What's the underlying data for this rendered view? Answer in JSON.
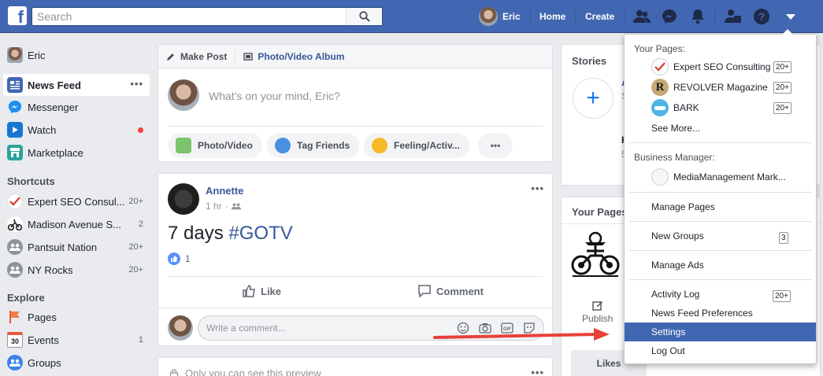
{
  "topbar": {
    "search_placeholder": "Search",
    "user_name": "Eric",
    "home_label": "Home",
    "create_label": "Create"
  },
  "leftnav": {
    "user": "Eric",
    "items": [
      {
        "label": "News Feed",
        "icon": "newsfeed-icon"
      },
      {
        "label": "Messenger",
        "icon": "messenger-icon"
      },
      {
        "label": "Watch",
        "icon": "watch-icon"
      },
      {
        "label": "Marketplace",
        "icon": "marketplace-icon"
      }
    ],
    "shortcuts_title": "Shortcuts",
    "shortcuts": [
      {
        "label": "Expert SEO Consul...",
        "count": "20+"
      },
      {
        "label": "Madison Avenue S...",
        "count": "2"
      },
      {
        "label": "Pantsuit Nation",
        "count": "20+"
      },
      {
        "label": "NY Rocks",
        "count": "20+"
      }
    ],
    "explore_title": "Explore",
    "explore": [
      {
        "label": "Pages",
        "count": ""
      },
      {
        "label": "Events",
        "count": "1",
        "icon_text": "30"
      },
      {
        "label": "Groups",
        "count": ""
      }
    ]
  },
  "composer": {
    "tab_make_post": "Make Post",
    "tab_album": "Photo/Video Album",
    "placeholder": "What's on your mind, Eric?",
    "btn_photo": "Photo/Video",
    "btn_tag": "Tag Friends",
    "btn_feeling": "Feeling/Activ..."
  },
  "post": {
    "author": "Annette",
    "time": "1 hr",
    "text_plain": "7 days ",
    "text_tag": "#GOTV",
    "likes": "1",
    "like_label": "Like",
    "comment_label": "Comment",
    "comment_placeholder": "Write a comment..."
  },
  "preview": {
    "text": "Only you can see this preview"
  },
  "right": {
    "stories_title": "Stories",
    "your_pages_title": "Your Pages",
    "publish_label": "Publish",
    "likes_label": "Likes"
  },
  "dropdown": {
    "your_pages_head": "Your Pages:",
    "pages": [
      {
        "label": "Expert SEO Consulting",
        "badge": "20+"
      },
      {
        "label": "REVOLVER Magazine",
        "badge": "20+"
      },
      {
        "label": "BARK",
        "badge": "20+"
      }
    ],
    "see_more": "See More...",
    "bm_head": "Business Manager:",
    "bm_item": "MediaManagement Mark...",
    "manage_pages": "Manage Pages",
    "new_groups": "New Groups",
    "new_groups_badge": "3",
    "manage_ads": "Manage Ads",
    "activity_log": "Activity Log",
    "activity_badge": "20+",
    "news_feed_prefs": "News Feed Preferences",
    "settings": "Settings",
    "log_out": "Log Out"
  },
  "colors": {
    "brand": "#4267b2",
    "link": "#365899",
    "arrow": "#e8403a",
    "notify_dot": "#fa3e3e"
  }
}
